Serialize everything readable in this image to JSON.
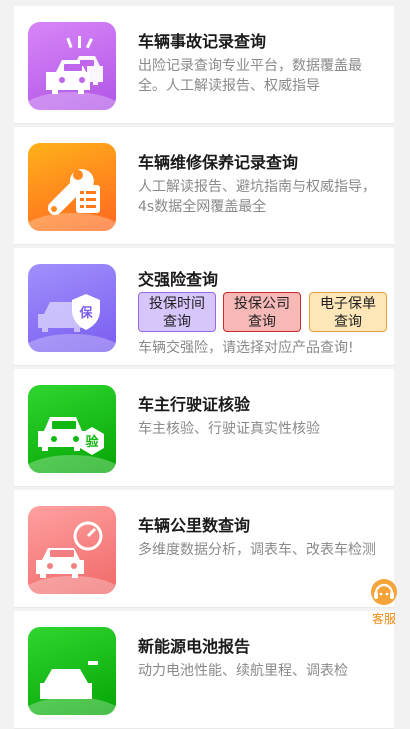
{
  "services": [
    {
      "title": "车辆事故记录查询",
      "desc": "出险记录查询专业平台，数据覆盖最全。人工解读报告、权威指导",
      "icon": "car-crash-icon",
      "color_from": "#d47bf6",
      "color_to": "#b45ae8"
    },
    {
      "title": "车辆维修保养记录查询",
      "desc": "人工解读报告、避坑指南与权威指导，4s数据全网覆盖最全",
      "icon": "wrench-report-icon",
      "color_from": "#ffae1a",
      "color_to": "#ff6a1f"
    },
    {
      "title": "交强险查询",
      "desc": "车辆交强险，请选择对应产品查询!",
      "icon": "car-insurance-icon",
      "color_from": "#9b8bfb",
      "color_to": "#7a5ff2",
      "tags": [
        {
          "line1": "投保时间",
          "line2": "查询",
          "bg": "#d7c6fb",
          "border": "#9a6be8"
        },
        {
          "line1": "投保公司",
          "line2": "查询",
          "bg": "#f7b8b8",
          "border": "#d22a2a"
        },
        {
          "line1": "电子保单",
          "line2": "查询",
          "bg": "#fde7b8",
          "border": "#e7a43a"
        }
      ]
    },
    {
      "title": "车主行驶证核验",
      "desc": "车主核验、行驶证真实性核验",
      "icon": "license-verify-icon",
      "color_from": "#2ad12a",
      "color_to": "#06a806"
    },
    {
      "title": "车辆公里数查询",
      "desc": "多维度数据分析，调表车、改表车检测",
      "icon": "odometer-car-icon",
      "color_from": "#ff9a9a",
      "color_to": "#f26b6b"
    },
    {
      "title": "新能源电池报告",
      "desc": "动力电池性能、续航里程、调表检",
      "icon": "ev-battery-icon",
      "color_from": "#2ad12a",
      "color_to": "#06a806"
    }
  ],
  "customer_service": {
    "label": "客服",
    "icon": "headset-icon",
    "color": "#f08a12"
  }
}
